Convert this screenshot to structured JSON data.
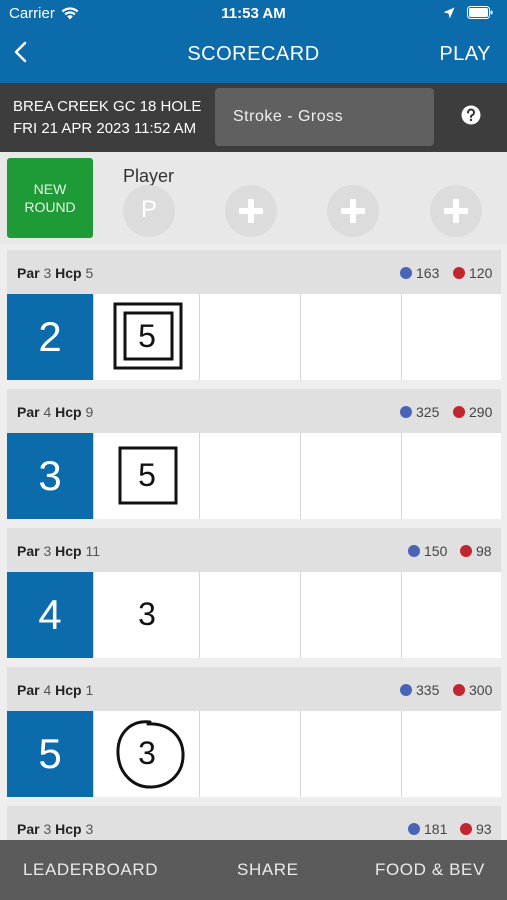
{
  "status": {
    "carrier": "Carrier",
    "time": "11:53 AM"
  },
  "nav": {
    "title": "SCORECARD",
    "play": "PLAY"
  },
  "course": {
    "name": "BREA CREEK GC 18 HOLE",
    "datetime": "FRI 21 APR 2023 11:52 AM",
    "mode": "Stroke - Gross"
  },
  "players": {
    "new_round_line1": "NEW",
    "new_round_line2": "ROUND",
    "label": "Player",
    "initial": "P"
  },
  "labels": {
    "par": "Par",
    "hcp": "Hcp"
  },
  "holes": [
    {
      "number": "2",
      "par": "3",
      "hcp": "5",
      "blue": "163",
      "red": "120",
      "score": "5",
      "mark": "double-square"
    },
    {
      "number": "3",
      "par": "4",
      "hcp": "9",
      "blue": "325",
      "red": "290",
      "score": "5",
      "mark": "square"
    },
    {
      "number": "4",
      "par": "3",
      "hcp": "11",
      "blue": "150",
      "red": "98",
      "score": "3",
      "mark": "none"
    },
    {
      "number": "5",
      "par": "4",
      "hcp": "1",
      "blue": "335",
      "red": "300",
      "score": "3",
      "mark": "circle"
    },
    {
      "number": "",
      "par": "3",
      "hcp": "3",
      "blue": "181",
      "red": "93",
      "score": "",
      "mark": "none"
    }
  ],
  "bottom": {
    "leaderboard": "LEADERBOARD",
    "share": "SHARE",
    "food": "FOOD & BEV"
  },
  "colors": {
    "primary": "#0c6cab",
    "green": "#1e9a36",
    "tee_blue": "#4a63b6",
    "tee_red": "#c0262f"
  }
}
